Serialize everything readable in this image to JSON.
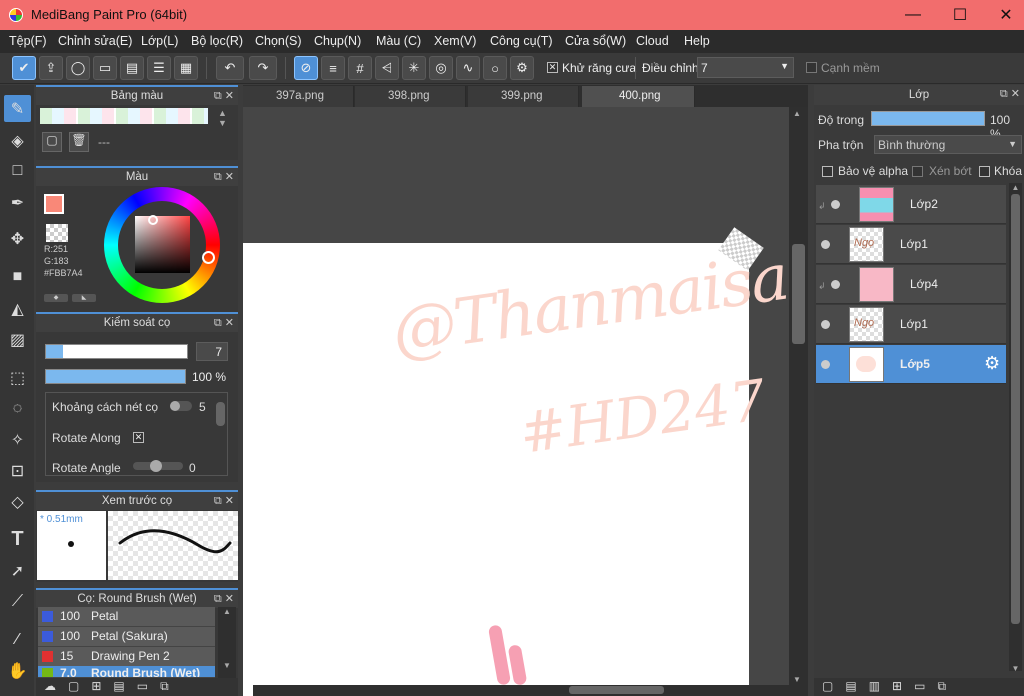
{
  "app": {
    "title": "MediBang Paint Pro (64bit)",
    "win_minimize": "—",
    "win_maximize": "☐",
    "win_close": "✕"
  },
  "menu": [
    "Tệp(F)",
    "Chỉnh sửa(E)",
    "Lớp(L)",
    "Bộ lọc(R)",
    "Chọn(S)",
    "Chụp(N)",
    "Màu (C)",
    "Xem(V)",
    "Công cụ(T)",
    "Cửa sổ(W)",
    "Cloud",
    "Help"
  ],
  "toolbar": {
    "antialias_label": "Khử răng cưa",
    "adjust_label": "Điều chỉnh",
    "adjust_value": "7",
    "soft_edge_label": "Cạnh mềm"
  },
  "panels": {
    "palette": {
      "title": "Bảng màu",
      "name": "---"
    },
    "color": {
      "title": "Màu",
      "r": "R:251",
      "g": "G:183",
      "hex": "#FBB7A4",
      "primary": "#f98878"
    },
    "brush_control": {
      "title": "Kiểm soát cọ",
      "size": "7",
      "opacity": "100 %",
      "spacing_label": "Khoảng cách nét cọ",
      "spacing_value": "5",
      "rotate_along_label": "Rotate Along",
      "rotate_angle_label": "Rotate Angle",
      "rotate_angle_value": "0"
    },
    "brush_preview": {
      "title": "Xem trước cọ",
      "size": "* 0.51mm"
    },
    "brush_list": {
      "title": "Cọ: Round Brush (Wet)",
      "items": [
        {
          "size": "100",
          "name": "Petal",
          "color": "#3b5bdb"
        },
        {
          "size": "100",
          "name": "Petal (Sakura)",
          "color": "#3b5bdb"
        },
        {
          "size": "15",
          "name": "Drawing Pen 2",
          "color": "#e03131"
        },
        {
          "size": "7.0",
          "name": "Round Brush (Wet)",
          "color": "#74b816"
        }
      ]
    }
  },
  "tabs": [
    "397a.png",
    "398.png",
    "399.png",
    "400.png"
  ],
  "canvas_text": {
    "line1": "@Thanmaisa",
    "line2": "#HD247"
  },
  "layers_panel": {
    "title": "Lớp",
    "opacity_label": "Độ trong",
    "opacity_value": "100 %",
    "blend_label": "Pha trộn",
    "blend_value": "Bình thường",
    "protect_alpha": "Bảo vệ alpha",
    "clip": "Xén bớt",
    "lock": "Khóa",
    "layers": [
      {
        "name": "Lớp2",
        "clipped": true
      },
      {
        "name": "Lớp1",
        "clipped": false
      },
      {
        "name": "Lớp4",
        "clipped": true
      },
      {
        "name": "Lớp1",
        "clipped": false
      },
      {
        "name": "Lớp5",
        "clipped": false,
        "selected": true
      }
    ]
  }
}
